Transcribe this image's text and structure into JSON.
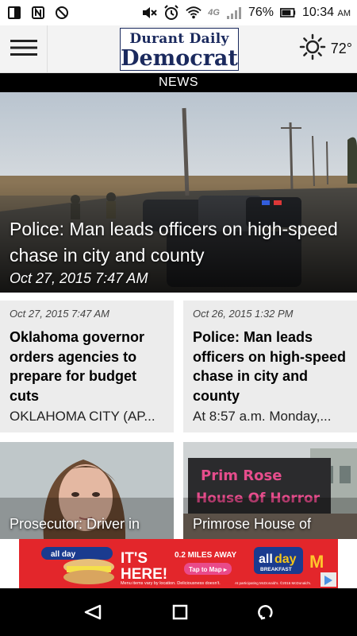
{
  "status_bar": {
    "battery": "76%",
    "time": "10:34",
    "ampm": "AM",
    "network": "4G"
  },
  "app_bar": {
    "logo_line1": "Durant Daily",
    "logo_line2": "Democrat",
    "temperature": "72°",
    "weather_icon": "sun-icon"
  },
  "section": {
    "title": "NEWS"
  },
  "hero": {
    "title": "Police: Man leads officers on high-speed chase in city and county",
    "date": "Oct 27, 2015 7:47 AM"
  },
  "cards": [
    {
      "date": "Oct 27, 2015 7:47 AM",
      "title": "Oklahoma governor orders agencies to prepare for budget cuts",
      "snippet": "OKLAHOMA CITY (AP..."
    },
    {
      "date": "Oct 26, 2015 1:32 PM",
      "title": "Police: Man leads officers on high-speed chase in city and county",
      "snippet": "At 8:57 a.m. Monday,..."
    }
  ],
  "thumbs": [
    {
      "title": "Prosecutor: Driver in"
    },
    {
      "title": "Primrose House of",
      "sign_line1": "Prim Rose",
      "sign_line2": "House Of Horror"
    }
  ],
  "ad": {
    "headline_1": "IT'S",
    "headline_2": "HERE!",
    "distance": "0.2 MILES AWAY",
    "cta": "Tap to Map ▸",
    "brand_1": "all",
    "brand_2": "day",
    "brand_sub": "BREAKFAST",
    "wrapper_label": "all day",
    "fine_print": "Menu items vary by location. Deliciousness doesn't.",
    "footer": "At participating McDonald's. ©2016 McDonald's."
  }
}
